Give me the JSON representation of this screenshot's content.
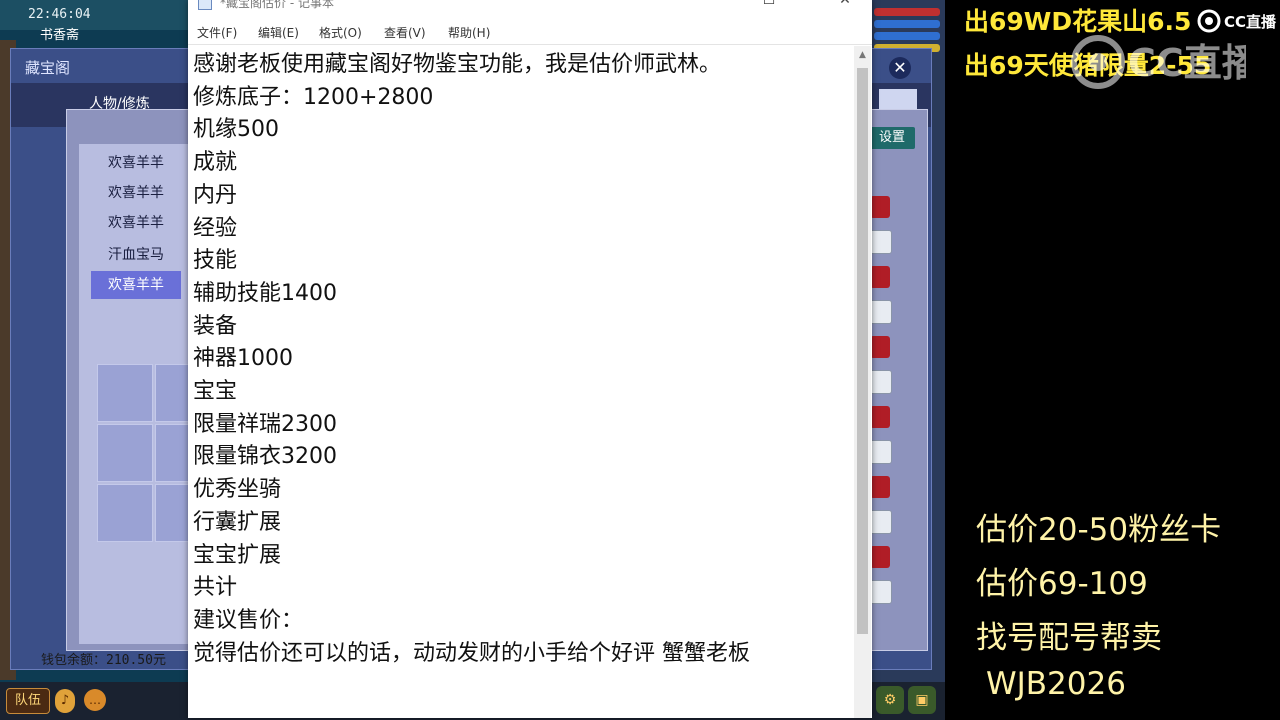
{
  "game": {
    "clock": "22:46:04",
    "location": "书香斋",
    "panel_title": "藏宝阁",
    "tab_label": "人物/修炼",
    "settings_label": "设置",
    "list_items": [
      "欢喜羊羊",
      "欢喜羊羊",
      "欢喜羊羊",
      "汗血宝马",
      "欢喜羊羊"
    ],
    "selected_index": 4,
    "wallet": "钱包余额：210.50元",
    "team_label": "队伍"
  },
  "notepad": {
    "window_title": "*藏宝阁估价 - 记事本",
    "menu": [
      "文件(F)",
      "编辑(E)",
      "格式(O)",
      "查看(V)",
      "帮助(H)"
    ],
    "lines": [
      "感谢老板使用藏宝阁好物鉴宝功能，我是估价师武林。",
      "修炼底子：1200+2800",
      "机缘500",
      "成就",
      "内丹",
      "经验",
      "技能",
      "辅助技能1400",
      "装备",
      "神器1000",
      "宝宝",
      "限量祥瑞2300",
      "限量锦衣3200",
      "优秀坐骑",
      "行囊扩展",
      "宝宝扩展",
      "共计",
      "建议售价：",
      "觉得估价还可以的话，动动发财的小手给个好评 蟹蟹老板"
    ]
  },
  "overlay": {
    "top_lines": [
      "出69WD花果山6.5",
      "出69天使猪限量2-55"
    ],
    "bottom_lines": [
      "估价20-50粉丝卡",
      "估价69-109",
      "找号配号帮卖",
      "WJB2026"
    ],
    "logo_text": "CC直播",
    "text_color": "#ffe83a"
  }
}
